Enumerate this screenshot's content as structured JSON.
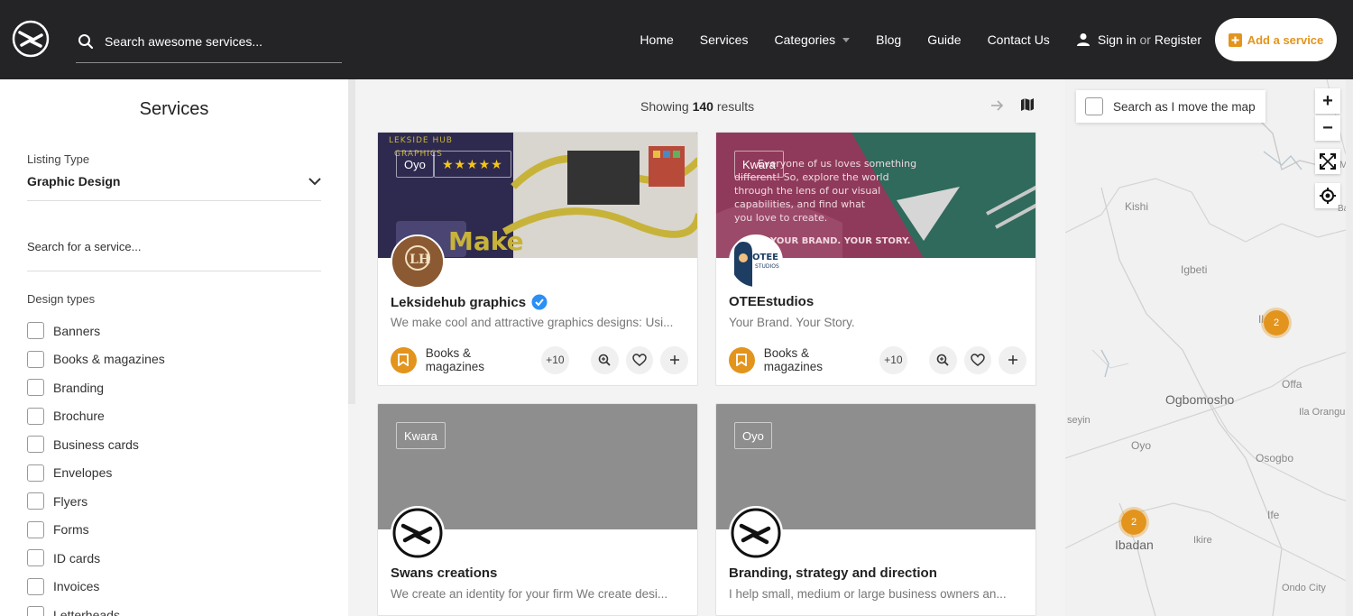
{
  "header": {
    "search_placeholder": "Search awesome services...",
    "nav": [
      "Home",
      "Services",
      "Categories",
      "Blog",
      "Guide",
      "Contact Us"
    ],
    "signin_prefix": "Sign in",
    "signin_or": "or",
    "signin_register": "Register",
    "add_service": "Add a service"
  },
  "sidebar": {
    "title": "Services",
    "listing_type_label": "Listing Type",
    "listing_type_value": "Graphic Design",
    "search_placeholder": "Search for a service...",
    "design_types_label": "Design types",
    "design_types": [
      "Banners",
      "Books & magazines",
      "Branding",
      "Brochure",
      "Business cards",
      "Envelopes",
      "Flyers",
      "Forms",
      "ID cards",
      "Invoices",
      "Letterheads"
    ]
  },
  "results": {
    "showing_prefix": "Showing",
    "count": "140",
    "showing_suffix": "results"
  },
  "cards": [
    {
      "tag": "Oyo",
      "stars": "★★★★★",
      "title": "Leksidehub graphics",
      "verified": true,
      "description": "We make cool and attractive graphics designs: Usi...",
      "category": "Books & magazines",
      "more": "+10",
      "banner_text_1": "LEKSIDE HUB",
      "banner_text_2": "GRAPHICS",
      "banner_text_3": "Make"
    },
    {
      "tag": "Kwara",
      "title": "OTEEstudios",
      "verified": false,
      "description": "Your Brand. Your Story.",
      "category": "Books & magazines",
      "more": "+10",
      "banner_text": "Everyone of us loves something different! So, explore the world through the lens of our visual capabilities, and find what you love to create.",
      "banner_text_2": "YOUR BRAND. YOUR STORY."
    },
    {
      "tag": "Kwara",
      "title": "Swans creations",
      "description": "We create an identity for your firm We create desi..."
    },
    {
      "tag": "Oyo",
      "title": "Branding, strategy and direction",
      "description": "I help small, medium or large business owners an..."
    }
  ],
  "map": {
    "search_as_move": "Search as I move the map",
    "labels": [
      "Kishi",
      "Igbeti",
      "Ilor",
      "Offa",
      "Ogbomosho",
      "Ila Orangun",
      "Oyo",
      "Osogbo",
      "seyin",
      "Ife",
      "Ikire",
      "Ibadan",
      "Ondo City",
      "Me",
      "Basita"
    ],
    "clusters": [
      "2",
      "2"
    ],
    "accent": "#e3941c"
  }
}
